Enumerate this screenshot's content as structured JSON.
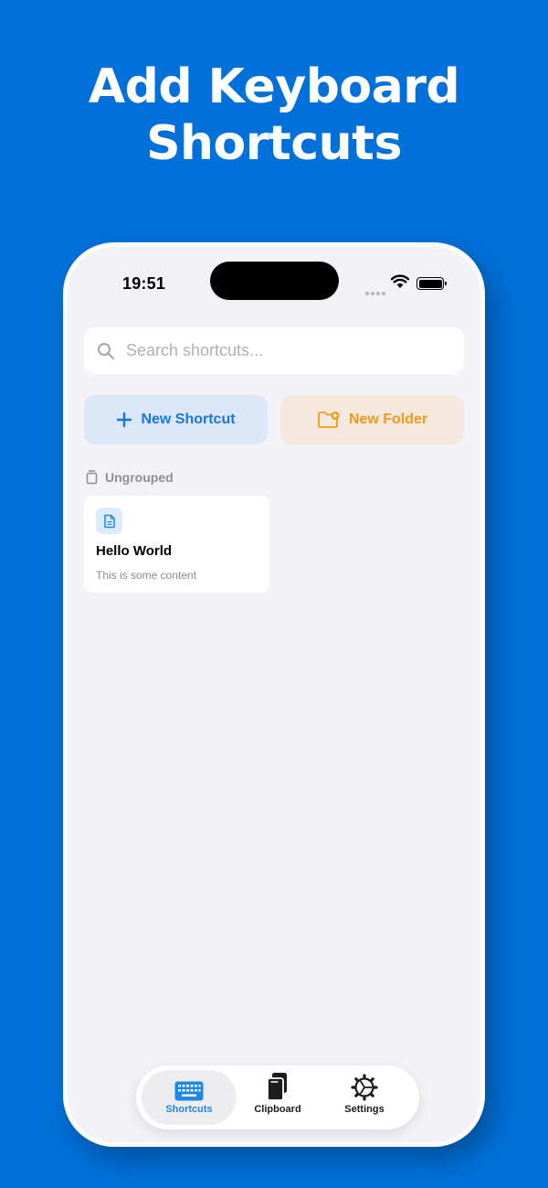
{
  "headline": {
    "line1": "Add Keyboard",
    "line2": "Shortcuts"
  },
  "status_bar": {
    "time": "19:51"
  },
  "search": {
    "placeholder": "Search shortcuts..."
  },
  "actions": {
    "new_shortcut_label": "New Shortcut",
    "new_folder_label": "New Folder"
  },
  "group": {
    "label": "Ungrouped"
  },
  "shortcuts": [
    {
      "title": "Hello World",
      "content": "This is some content"
    }
  ],
  "tabs": [
    {
      "label": "Shortcuts",
      "icon": "keyboard-icon",
      "selected": true
    },
    {
      "label": "Clipboard",
      "icon": "clipboard-icon",
      "selected": false
    },
    {
      "label": "Settings",
      "icon": "gear-icon",
      "selected": false
    }
  ],
  "colors": {
    "background": "#0170D9",
    "accent": "#1577E6",
    "folder_accent": "#F29A18",
    "phone_bg": "#F2F2F7"
  }
}
